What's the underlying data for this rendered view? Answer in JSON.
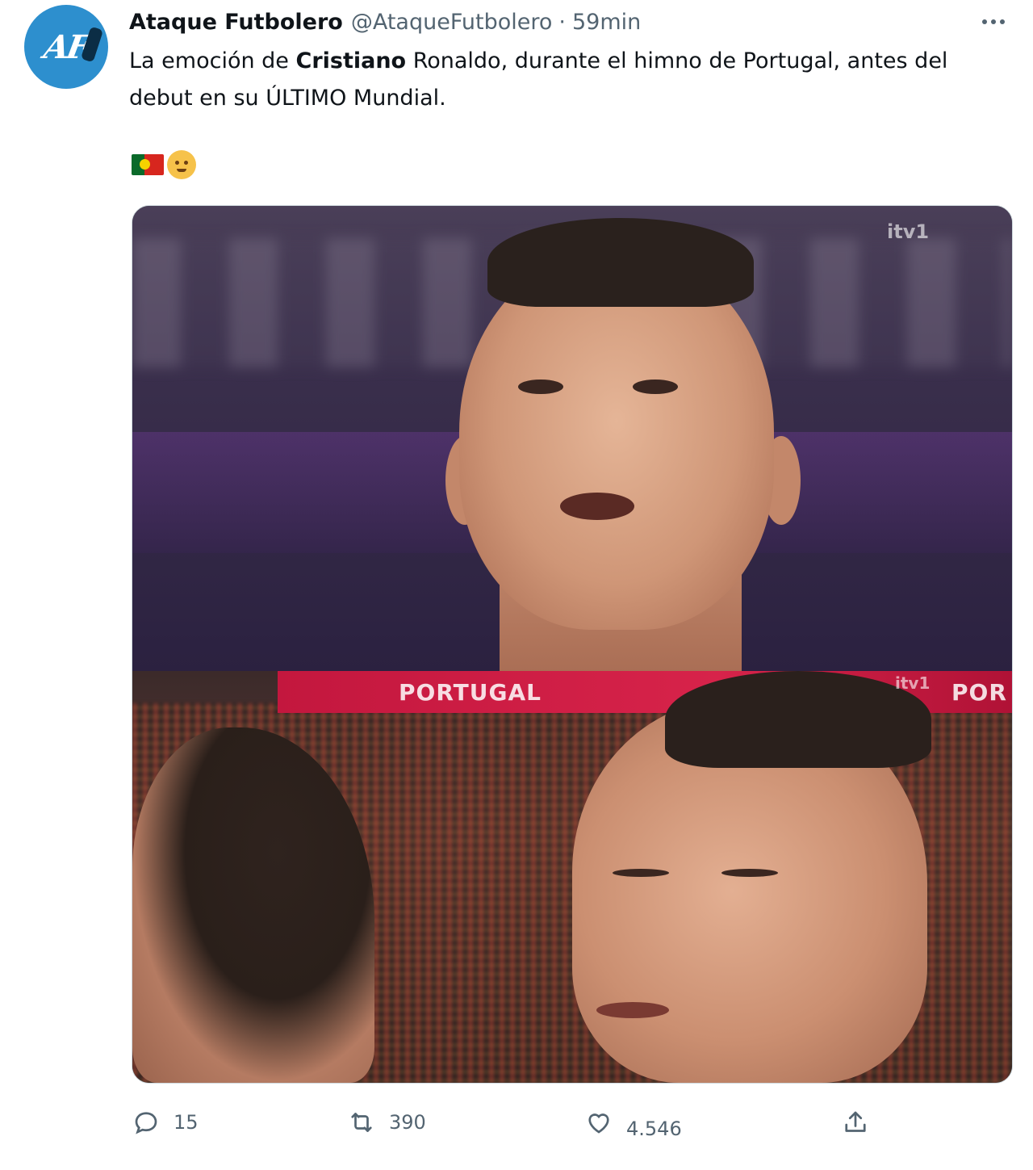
{
  "author": {
    "display_name": "Ataque Futbolero",
    "handle": "@AtaqueFutbolero",
    "separator": "·",
    "timestamp": "59min",
    "avatar_text": "AF"
  },
  "tweet": {
    "text_part1": "La emoción de ",
    "text_bold": "Cristiano",
    "text_part2": " Ronaldo, durante el himno de Portugal, antes del debut en su ÚLTIMO Mundial."
  },
  "media": {
    "watermark_top": "itv1",
    "watermark_bottom": "itv1",
    "banner_text": "PORTUGAL",
    "banner_text_edge": "POR"
  },
  "actions": {
    "reply_count": "15",
    "retweet_count": "390",
    "like_count": "4.546"
  },
  "icons": {
    "more": "more-horizontal-icon",
    "reply": "reply-icon",
    "retweet": "retweet-icon",
    "like": "heart-icon",
    "share": "share-icon"
  },
  "colors": {
    "text_primary": "#0f1419",
    "text_secondary": "#536471",
    "avatar_bg": "#2d8fce"
  }
}
